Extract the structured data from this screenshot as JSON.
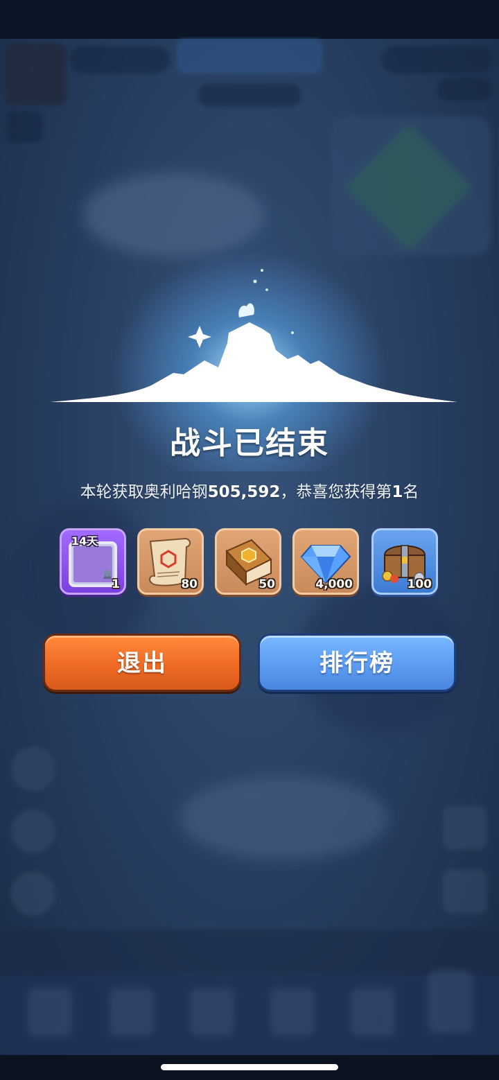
{
  "result": {
    "title": "战斗已结束",
    "subtitle_prefix": "本轮获取奥利哈钢",
    "amount": "505,592",
    "subtitle_middle": "，恭喜您获得第",
    "rank": "1",
    "subtitle_suffix": "名"
  },
  "rewards": [
    {
      "icon": "avatar-frame-icon",
      "duration": "14天",
      "quantity": "1"
    },
    {
      "icon": "scroll-icon",
      "quantity": "80"
    },
    {
      "icon": "book-icon",
      "quantity": "50"
    },
    {
      "icon": "diamond-icon",
      "quantity": "4,000"
    },
    {
      "icon": "treasure-chest-icon",
      "quantity": "100"
    }
  ],
  "buttons": {
    "exit_label": "退出",
    "leaderboard_label": "排行榜"
  },
  "colors": {
    "exit_button": "#ef6b25",
    "leaderboard_button": "#5b9cf2",
    "glow": "#aae1ff"
  }
}
